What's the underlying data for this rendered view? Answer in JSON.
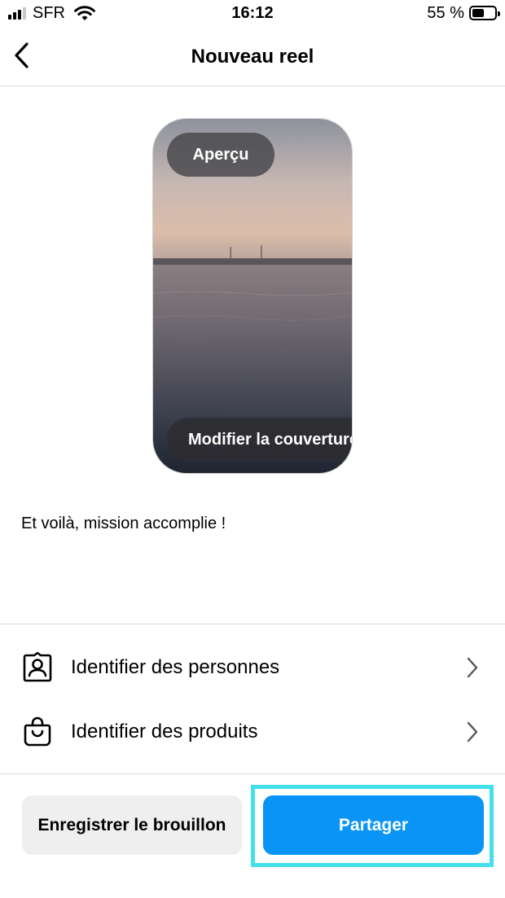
{
  "status_bar": {
    "carrier": "SFR",
    "time": "16:12",
    "battery_text": "55 %",
    "battery_level": 0.55,
    "signal_bars": 3
  },
  "header": {
    "title": "Nouveau reel",
    "back_icon": "chevron-left-icon"
  },
  "preview": {
    "apercu_label": "Aperçu",
    "cover_label": "Modifier la couverture"
  },
  "caption": "Et voilà, mission accomplie !",
  "options": [
    {
      "label": "Identifier des personnes",
      "icon": "tag-people-icon"
    },
    {
      "label": "Identifier des produits",
      "icon": "shopping-bag-icon"
    }
  ],
  "actions": {
    "draft_label": "Enregistrer le brouillon",
    "share_label": "Partager"
  },
  "colors": {
    "share_button": "#0a95f6",
    "draft_button": "#efefef",
    "highlight": "#44e0ec"
  }
}
